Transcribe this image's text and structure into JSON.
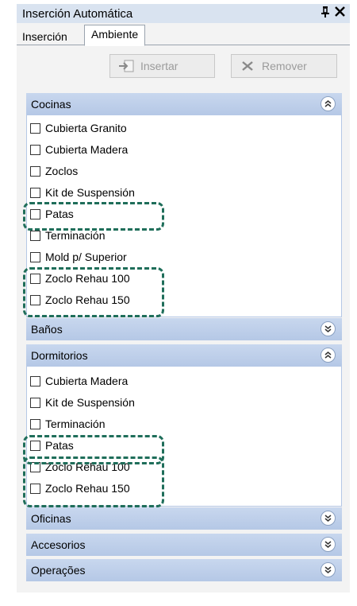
{
  "window": {
    "title": "Inserción Automática",
    "pin_glyph": "҉",
    "close_glyph": "✕"
  },
  "tabs": [
    {
      "label": "Inserción"
    },
    {
      "label": "Ambiente"
    }
  ],
  "toolbar": {
    "insert_label": "Insertar",
    "remove_label": "Remover"
  },
  "groups": {
    "cocinas": {
      "label": "Cocinas",
      "items": [
        "Cubierta Granito",
        "Cubierta Madera",
        "Zoclos",
        "Kit de Suspensión",
        "Patas",
        "Terminación",
        "Mold p/ Superior",
        "Zoclo Rehau 100",
        "Zoclo Rehau 150"
      ]
    },
    "banos": {
      "label": "Baños"
    },
    "dormitorios": {
      "label": "Dormitorios",
      "items": [
        "Cubierta Madera",
        "Kit de Suspensión",
        "Terminación",
        "Patas",
        "Zoclo Rehau 100",
        "Zoclo Rehau 150"
      ]
    },
    "oficinas": {
      "label": "Oficinas"
    },
    "accesorios": {
      "label": "Accesorios"
    },
    "operacoes": {
      "label": "Operações"
    }
  },
  "colors": {
    "highlight": "#1f6e5a",
    "group_header": "#b5c8e6",
    "title_bar": "#d9e3f0"
  }
}
